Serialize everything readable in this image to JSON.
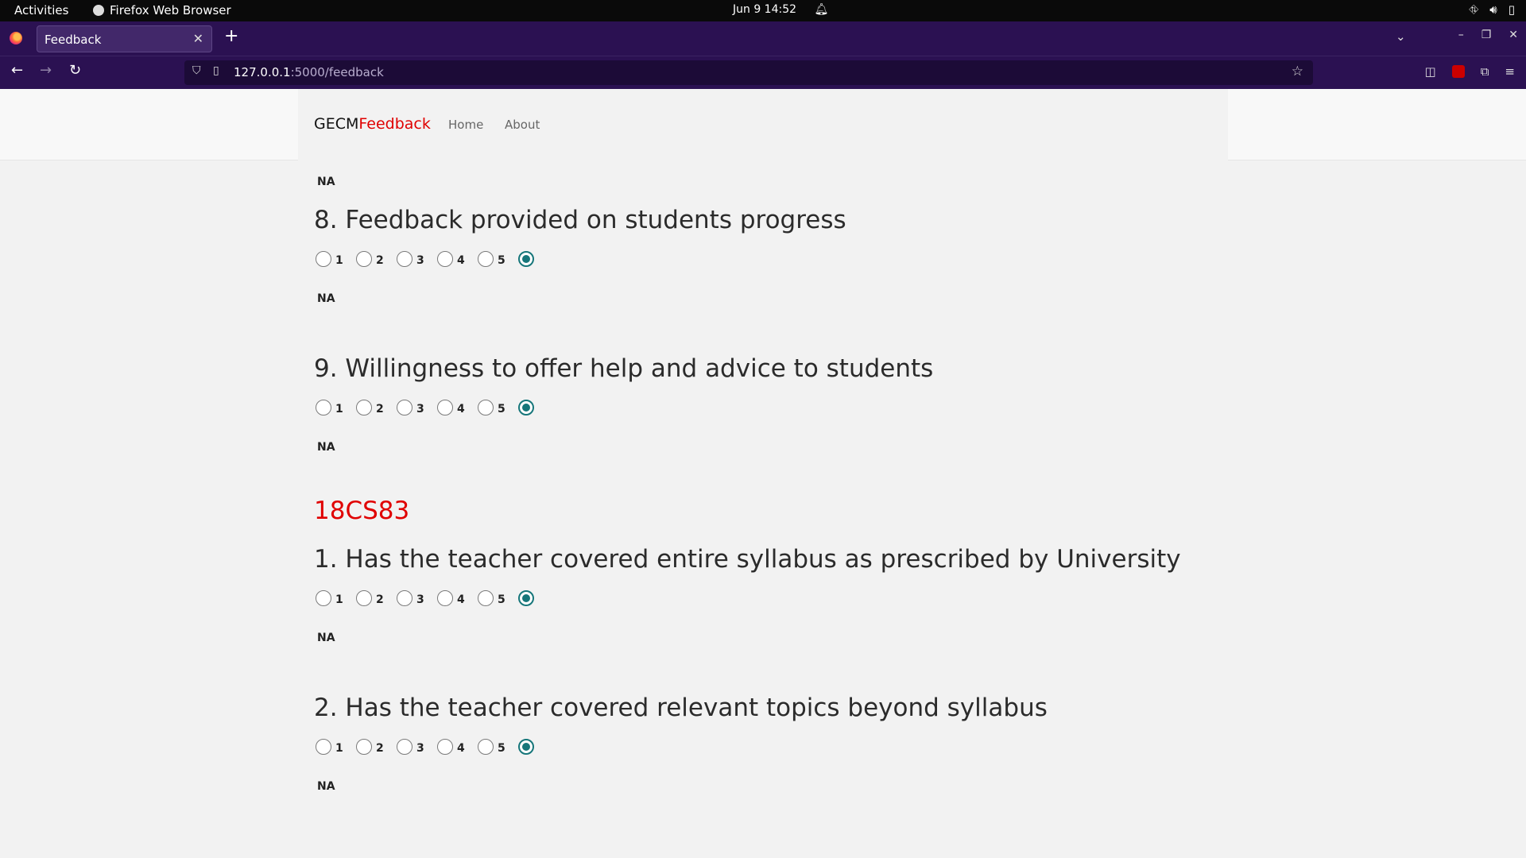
{
  "system_bar": {
    "activities": "Activities",
    "app_name": "Firefox Web Browser",
    "clock": "Jun 9  14:52"
  },
  "browser": {
    "tab_title": "Feedback",
    "url_host": "127.0.0.1",
    "url_path": ":5000/feedback"
  },
  "site": {
    "brand_main": "GECM",
    "brand_accent": "Feedback",
    "nav": [
      "Home",
      "About"
    ]
  },
  "form": {
    "top_na_label": "NA",
    "option_labels": [
      "1",
      "2",
      "3",
      "4",
      "5"
    ],
    "na_label": "NA",
    "questions": [
      {
        "text": "8. Feedback provided on students progress",
        "selected": "NA"
      },
      {
        "text": "9. Willingness to offer help and advice to students",
        "selected": "NA"
      }
    ],
    "subject": "18CS83",
    "subject_questions": [
      {
        "text": "1. Has the teacher covered entire syllabus as prescribed by University",
        "selected": "NA"
      },
      {
        "text": "2. Has the teacher covered relevant topics beyond syllabus",
        "selected": "NA"
      }
    ]
  },
  "colors": {
    "accent_red": "#e00000",
    "radio_selected": "#16767a",
    "browser_chrome": "#2b1152"
  }
}
